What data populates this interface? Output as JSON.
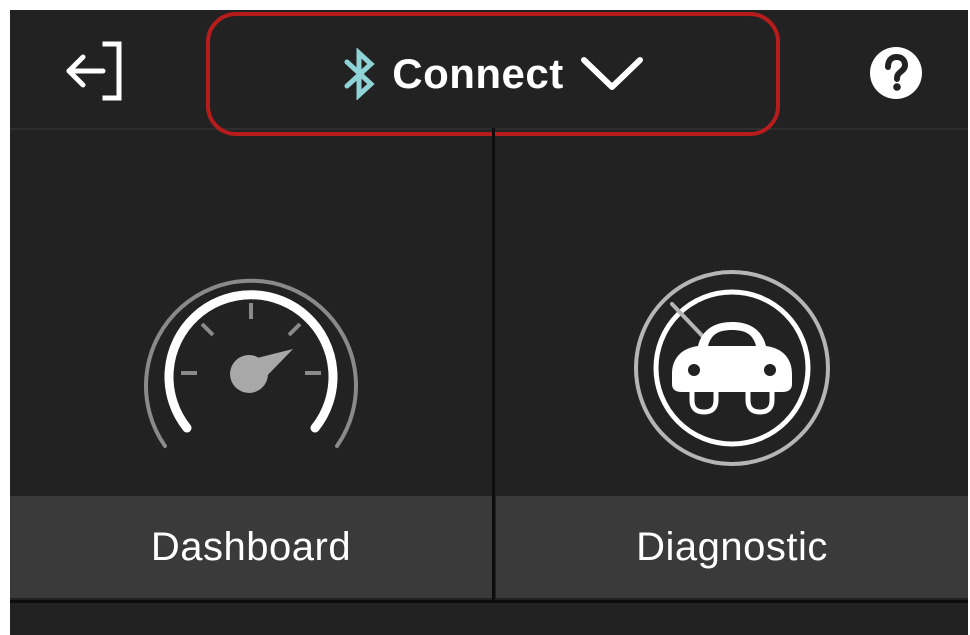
{
  "header": {
    "connect_label": "Connect",
    "exit_icon": "exit-arrow-icon",
    "bluetooth_icon": "bluetooth-icon",
    "chevron_icon": "chevron-down-icon",
    "help_icon": "help-icon"
  },
  "tiles": [
    {
      "label": "Dashboard",
      "icon": "speedometer-icon"
    },
    {
      "label": "Diagnostic",
      "icon": "car-diagnostic-icon"
    }
  ],
  "colors": {
    "background": "#222222",
    "label_bar": "#3a3a3a",
    "bluetooth": "#8fd3d6",
    "highlight": "#b71c1c",
    "text": "#ffffff"
  }
}
